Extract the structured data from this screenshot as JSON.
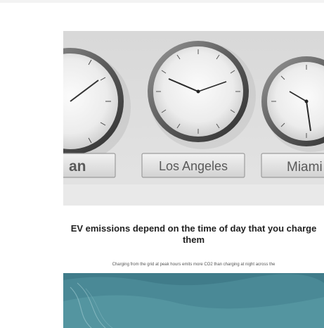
{
  "article": {
    "image_labels": {
      "left": "an",
      "center": "Los Angeles",
      "right": "Miami"
    },
    "headline": "EV emissions depend on the time of day that you charge them",
    "teaser": "Charging from the grid at peak hours emits more CO2 than charging at night across the"
  }
}
